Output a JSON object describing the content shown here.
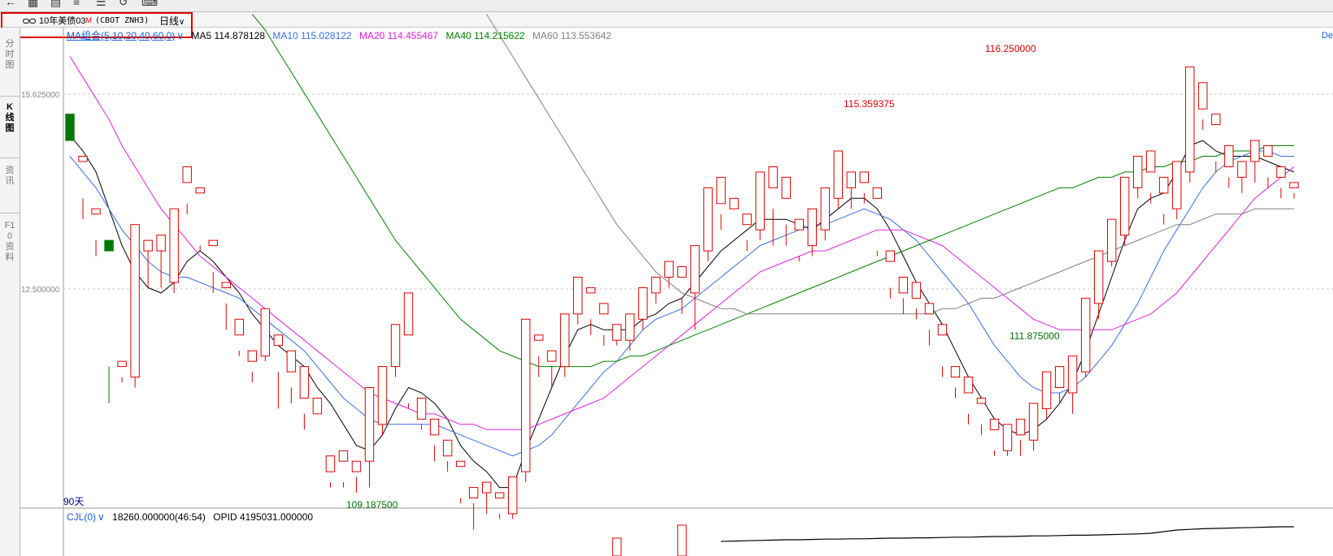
{
  "toolbar": {
    "icons": [
      "back-icon",
      "grid-icon",
      "chart-icon",
      "bars-icon",
      "list-icon",
      "refresh-icon",
      "text-icon"
    ]
  },
  "symbol": {
    "name": "10年美债03",
    "badge": "M",
    "code": "(CBOT ZNH3)",
    "period": "日线"
  },
  "tabs": [
    "分时图",
    "K线图",
    "资讯",
    "F10资料"
  ],
  "ma_legend": {
    "combo": "MA组合(5,10,20,40,60,0)",
    "items": [
      {
        "text": "MA5 114.878128",
        "color": "#000000"
      },
      {
        "text": "MA10 115.028122",
        "color": "#3b6fe0"
      },
      {
        "text": "MA20 114.455467",
        "color": "#e020e0"
      },
      {
        "text": "MA40 114.215622",
        "color": "#008000"
      },
      {
        "text": "MA60 113.553642",
        "color": "#808080"
      }
    ]
  },
  "right_label": "De",
  "period_label": "90天",
  "sub_legend": {
    "name": "CJL(0)",
    "value": "18260.000000(46:54)",
    "opid": "OPID 4195031.000000"
  },
  "chart_data": {
    "type": "candlestick",
    "y_ticks": [
      "15.625000",
      "12.500000"
    ],
    "annotations": [
      {
        "text": "116.250000",
        "type": "max",
        "color": "#e00000"
      },
      {
        "text": "115.359375",
        "type": "local-high",
        "color": "#e00000"
      },
      {
        "text": "111.875000",
        "type": "local-low",
        "color": "#007000"
      },
      {
        "text": "109.187500",
        "type": "min",
        "color": "#007000"
      }
    ],
    "colors": {
      "up": "#e00000",
      "down": "#007800"
    },
    "candles": [
      [
        115.4,
        114.9,
        115.2,
        115.0
      ],
      [
        114.5,
        114.6,
        113.4,
        113.8
      ],
      [
        113.5,
        113.6,
        112.7,
        113.0
      ],
      [
        113.0,
        112.8,
        109.9,
        110.6
      ],
      [
        110.6,
        110.7,
        110.3,
        110.4
      ],
      [
        110.4,
        113.3,
        110.2,
        113.0
      ],
      [
        112.8,
        113.0,
        112.1,
        112.8
      ],
      [
        112.8,
        113.1,
        112.1,
        112.8
      ],
      [
        112.2,
        113.6,
        112.0,
        113.3
      ],
      [
        114.1,
        114.4,
        113.5,
        113.7
      ],
      [
        113.9,
        114.0,
        112.8,
        112.9
      ],
      [
        112.9,
        113.0,
        112.0,
        112.4
      ],
      [
        112.1,
        112.2,
        111.3,
        111.8
      ],
      [
        111.2,
        111.5,
        110.8,
        110.9
      ],
      [
        110.7,
        110.9,
        110.3,
        110.5
      ],
      [
        110.8,
        111.7,
        110.7,
        111.2
      ],
      [
        111.0,
        111.2,
        109.8,
        110.5
      ],
      [
        110.5,
        110.9,
        109.9,
        110.2
      ],
      [
        110.0,
        110.6,
        109.4,
        109.7
      ],
      [
        109.7,
        110.0,
        108.5,
        108.5
      ],
      [
        108.6,
        108.9,
        108.3,
        108.4
      ],
      [
        108.8,
        109.0,
        108.3,
        108.4
      ],
      [
        108.6,
        108.8,
        108.2,
        108.5
      ],
      [
        108.8,
        110.2,
        108.3,
        110.0
      ],
      [
        109.5,
        110.6,
        109.3,
        110.0
      ],
      [
        110.6,
        111.4,
        110.4,
        111.2
      ],
      [
        111.2,
        112.0,
        109.8,
        109.9
      ],
      [
        109.6,
        110.0,
        109.4,
        109.5
      ],
      [
        109.3,
        109.6,
        108.8,
        109.1
      ],
      [
        108.9,
        109.2,
        108.6,
        108.8
      ],
      [
        108.7,
        108.8,
        108.0,
        108.1
      ],
      [
        108.1,
        108.3,
        107.5,
        108.0
      ],
      [
        108.2,
        108.4,
        107.8,
        108.3
      ],
      [
        108.1,
        108.2,
        107.7,
        107.8
      ],
      [
        107.8,
        108.5,
        107.7,
        108.3
      ],
      [
        108.6,
        111.5,
        108.4,
        111.4
      ],
      [
        111.1,
        111.2,
        110.4,
        110.8
      ],
      [
        110.7,
        110.9,
        110.2,
        110.6
      ],
      [
        110.6,
        111.6,
        110.4,
        111.3
      ],
      [
        111.6,
        112.3,
        111.4,
        112.1
      ],
      [
        112.0,
        112.1,
        111.2,
        111.5
      ],
      [
        111.6,
        111.8,
        111.0,
        111.2
      ],
      [
        111.1,
        111.4,
        111.0,
        111.3
      ],
      [
        111.1,
        111.6,
        110.9,
        111.4
      ],
      [
        111.5,
        112.1,
        111.3,
        112.0
      ],
      [
        112.0,
        112.3,
        111.8,
        112.1
      ],
      [
        112.3,
        112.6,
        112.1,
        112.3
      ],
      [
        112.3,
        112.5,
        111.6,
        111.9
      ],
      [
        112.0,
        112.9,
        111.3,
        112.7
      ],
      [
        112.8,
        114.0,
        112.6,
        113.6
      ],
      [
        113.7,
        114.2,
        113.2,
        113.5
      ],
      [
        113.6,
        113.8,
        113.0,
        113.0
      ],
      [
        113.3,
        113.5,
        112.8,
        113.0
      ],
      [
        113.2,
        114.3,
        113.0,
        114.1
      ],
      [
        114.0,
        114.4,
        112.9,
        113.6
      ],
      [
        113.8,
        114.2,
        112.9,
        113.3
      ],
      [
        113.2,
        113.4,
        112.6,
        112.7
      ],
      [
        112.9,
        113.6,
        112.7,
        113.4
      ],
      [
        113.2,
        114.0,
        113.0,
        113.8
      ],
      [
        113.8,
        114.7,
        113.6,
        114.1
      ],
      [
        114.0,
        114.3,
        113.6,
        114.0
      ],
      [
        114.1,
        114.3,
        113.7,
        113.9
      ],
      [
        113.8,
        114.0,
        112.7,
        112.8
      ],
      [
        112.6,
        112.8,
        111.9,
        112.1
      ],
      [
        112.0,
        112.3,
        111.6,
        111.9
      ],
      [
        111.9,
        112.2,
        111.5,
        111.7
      ],
      [
        111.6,
        111.8,
        111.0,
        111.3
      ],
      [
        111.2,
        111.4,
        110.4,
        110.6
      ],
      [
        110.4,
        110.6,
        110.0,
        110.2
      ],
      [
        110.1,
        110.4,
        109.5,
        109.7
      ],
      [
        109.9,
        110.0,
        109.3,
        109.5
      ],
      [
        109.4,
        109.6,
        108.9,
        109.0
      ],
      [
        109.0,
        109.5,
        108.9,
        109.3
      ],
      [
        109.3,
        109.6,
        108.9,
        109.2
      ],
      [
        109.2,
        109.9,
        109.0,
        109.8
      ],
      [
        109.8,
        110.5,
        109.6,
        110.3
      ],
      [
        110.2,
        110.6,
        109.9,
        110.1
      ],
      [
        110.1,
        110.8,
        109.7,
        110.5
      ],
      [
        110.5,
        111.9,
        110.4,
        111.7
      ],
      [
        111.8,
        112.8,
        111.5,
        112.5
      ],
      [
        112.6,
        113.4,
        112.5,
        113.1
      ],
      [
        113.1,
        114.2,
        112.9,
        114.0
      ],
      [
        114.0,
        114.6,
        113.8,
        114.4
      ],
      [
        114.3,
        114.7,
        113.7,
        113.9
      ],
      [
        113.9,
        114.2,
        113.3,
        113.5
      ],
      [
        113.6,
        114.5,
        113.4,
        114.3
      ],
      [
        114.3,
        116.3,
        114.1,
        115.8
      ],
      [
        115.5,
        116.0,
        115.1,
        115.3
      ],
      [
        115.2,
        115.4,
        114.3,
        114.5
      ],
      [
        114.4,
        114.8,
        114.0,
        114.2
      ],
      [
        114.2,
        114.5,
        113.9,
        114.3
      ],
      [
        114.5,
        114.9,
        114.1,
        114.6
      ],
      [
        114.6,
        114.8,
        114.0,
        114.2
      ],
      [
        114.2,
        114.4,
        113.8,
        114.0
      ],
      [
        114.0,
        114.1,
        113.8,
        113.9
      ]
    ],
    "ma_series": [
      {
        "name": "MA5",
        "color": "#000000",
        "values": [
          115.0,
          114.7,
          114.3,
          113.6,
          112.9,
          112.4,
          112.1,
          112.0,
          112.2,
          112.6,
          112.8,
          112.6,
          112.3,
          112.0,
          111.6,
          111.3,
          111.0,
          110.8,
          110.6,
          110.2,
          109.9,
          109.5,
          109.1,
          109.0,
          109.3,
          109.8,
          110.2,
          110.1,
          109.9,
          109.6,
          109.1,
          108.8,
          108.6,
          108.3,
          108.3,
          109.0,
          109.6,
          110.2,
          110.8,
          111.3,
          111.4,
          111.3,
          111.3,
          111.3,
          111.5,
          111.6,
          111.8,
          111.9,
          112.2,
          112.5,
          112.8,
          113.0,
          113.2,
          113.4,
          113.4,
          113.4,
          113.3,
          113.2,
          113.4,
          113.6,
          113.8,
          113.8,
          113.6,
          113.2,
          112.7,
          112.2,
          111.8,
          111.4,
          110.9,
          110.4,
          110.0,
          109.6,
          109.4,
          109.3,
          109.4,
          109.6,
          109.9,
          110.3,
          110.9,
          111.6,
          112.3,
          113.0,
          113.6,
          113.8,
          113.9,
          114.3,
          114.8,
          114.9,
          114.7,
          114.6,
          114.6,
          114.6,
          114.5,
          114.4,
          114.3
        ]
      },
      {
        "name": "MA10",
        "color": "#3b6fe0",
        "values": [
          114.6,
          114.3,
          114.0,
          113.6,
          113.2,
          112.9,
          112.6,
          112.4,
          112.3,
          112.3,
          112.2,
          112.1,
          112.0,
          111.9,
          111.7,
          111.5,
          111.3,
          111.1,
          110.9,
          110.6,
          110.3,
          110.0,
          109.8,
          109.6,
          109.5,
          109.5,
          109.5,
          109.5,
          109.5,
          109.4,
          109.3,
          109.2,
          109.1,
          109.0,
          108.9,
          109.0,
          109.1,
          109.3,
          109.6,
          109.9,
          110.2,
          110.5,
          110.7,
          111.0,
          111.3,
          111.5,
          111.6,
          111.7,
          111.9,
          112.1,
          112.3,
          112.5,
          112.7,
          112.9,
          113.0,
          113.1,
          113.2,
          113.3,
          113.3,
          113.4,
          113.5,
          113.6,
          113.5,
          113.4,
          113.2,
          113.0,
          112.7,
          112.4,
          112.1,
          111.8,
          111.4,
          111.0,
          110.7,
          110.4,
          110.2,
          110.1,
          110.1,
          110.2,
          110.4,
          110.7,
          111.0,
          111.4,
          111.8,
          112.3,
          112.8,
          113.2,
          113.6,
          114.0,
          114.3,
          114.5,
          114.6,
          114.7,
          114.7,
          114.6,
          114.6
        ]
      },
      {
        "name": "MA20",
        "color": "#e020e0",
        "values": [
          116.5,
          116.1,
          115.7,
          115.3,
          114.8,
          114.4,
          114.0,
          113.6,
          113.3,
          113.0,
          112.7,
          112.5,
          112.3,
          112.1,
          111.9,
          111.7,
          111.5,
          111.3,
          111.1,
          110.9,
          110.7,
          110.5,
          110.3,
          110.1,
          110.0,
          109.9,
          109.8,
          109.7,
          109.7,
          109.6,
          109.5,
          109.5,
          109.4,
          109.4,
          109.4,
          109.4,
          109.5,
          109.6,
          109.7,
          109.8,
          109.9,
          110.0,
          110.2,
          110.4,
          110.6,
          110.8,
          111.0,
          111.2,
          111.4,
          111.6,
          111.8,
          112.0,
          112.2,
          112.4,
          112.5,
          112.6,
          112.7,
          112.8,
          112.8,
          112.9,
          113.0,
          113.1,
          113.2,
          113.2,
          113.2,
          113.1,
          113.0,
          112.9,
          112.7,
          112.5,
          112.3,
          112.1,
          111.9,
          111.7,
          111.5,
          111.4,
          111.3,
          111.3,
          111.3,
          111.3,
          111.3,
          111.4,
          111.5,
          111.6,
          111.8,
          112.0,
          112.3,
          112.6,
          112.9,
          113.2,
          113.5,
          113.8,
          114.0,
          114.2,
          114.4
        ]
      },
      {
        "name": "MA40",
        "color": "#008000",
        "values": [
          null,
          null,
          null,
          null,
          null,
          null,
          null,
          null,
          null,
          null,
          null,
          null,
          null,
          null,
          117.3,
          117.0,
          116.6,
          116.2,
          115.8,
          115.4,
          115.0,
          114.6,
          114.2,
          113.8,
          113.4,
          113.0,
          112.7,
          112.4,
          112.1,
          111.8,
          111.5,
          111.3,
          111.1,
          110.9,
          110.8,
          110.7,
          110.6,
          110.6,
          110.6,
          110.6,
          110.6,
          110.7,
          110.7,
          110.8,
          110.8,
          110.9,
          111.0,
          111.1,
          111.2,
          111.3,
          111.4,
          111.5,
          111.6,
          111.7,
          111.8,
          111.9,
          112.0,
          112.1,
          112.2,
          112.3,
          112.4,
          112.5,
          112.6,
          112.7,
          112.8,
          112.9,
          113.0,
          113.1,
          113.2,
          113.3,
          113.4,
          113.5,
          113.6,
          113.7,
          113.8,
          113.9,
          114.0,
          114.0,
          114.1,
          114.2,
          114.2,
          114.3,
          114.3,
          114.4,
          114.4,
          114.5,
          114.5,
          114.6,
          114.6,
          114.7,
          114.7,
          114.7,
          114.8,
          114.8,
          114.8
        ]
      },
      {
        "name": "MA60",
        "color": "#808080",
        "values": [
          null,
          null,
          null,
          null,
          null,
          null,
          null,
          null,
          null,
          null,
          null,
          null,
          null,
          null,
          null,
          null,
          null,
          null,
          null,
          null,
          null,
          null,
          null,
          null,
          null,
          null,
          null,
          null,
          null,
          null,
          null,
          null,
          117.3,
          116.9,
          116.5,
          116.1,
          115.7,
          115.3,
          114.9,
          114.5,
          114.1,
          113.7,
          113.3,
          113.0,
          112.7,
          112.4,
          112.2,
          112.0,
          111.9,
          111.8,
          111.7,
          111.7,
          111.6,
          111.6,
          111.6,
          111.6,
          111.6,
          111.6,
          111.6,
          111.6,
          111.6,
          111.6,
          111.6,
          111.6,
          111.6,
          111.6,
          111.6,
          111.7,
          111.7,
          111.8,
          111.9,
          111.9,
          112.0,
          112.1,
          112.2,
          112.3,
          112.4,
          112.5,
          112.6,
          112.7,
          112.8,
          112.9,
          113.0,
          113.1,
          113.2,
          113.3,
          113.3,
          113.4,
          113.5,
          113.5,
          113.5,
          113.6,
          113.6,
          113.6,
          113.6
        ]
      }
    ],
    "volume": {
      "line": [
        0,
        0,
        0,
        0,
        0,
        0,
        0,
        0,
        0,
        0,
        0,
        0,
        0,
        0,
        0,
        0,
        0,
        0,
        0,
        0,
        0,
        0,
        0,
        0,
        0,
        0,
        0,
        0,
        0,
        0,
        0,
        0,
        0,
        0,
        0,
        0,
        0,
        0,
        0,
        0,
        0,
        0,
        0,
        0,
        0,
        0,
        0,
        0,
        0,
        0,
        0.45,
        0.46,
        0.47,
        0.48,
        0.49,
        0.5,
        0.5,
        0.51,
        0.52,
        0.52,
        0.53,
        0.53,
        0.54,
        0.55,
        0.55,
        0.56,
        0.56,
        0.57,
        0.58,
        0.58,
        0.59,
        0.6,
        0.6,
        0.61,
        0.62,
        0.62,
        0.63,
        0.64,
        0.64,
        0.65,
        0.66,
        0.67,
        0.68,
        0.7,
        0.75,
        0.8,
        0.82,
        0.84,
        0.85,
        0.86,
        0.87,
        0.88,
        0.89,
        0.9,
        0.9
      ],
      "tall_bars": [
        {
          "index": 42,
          "value": 0.55
        },
        {
          "index": 47,
          "value": 0.95
        }
      ]
    }
  }
}
